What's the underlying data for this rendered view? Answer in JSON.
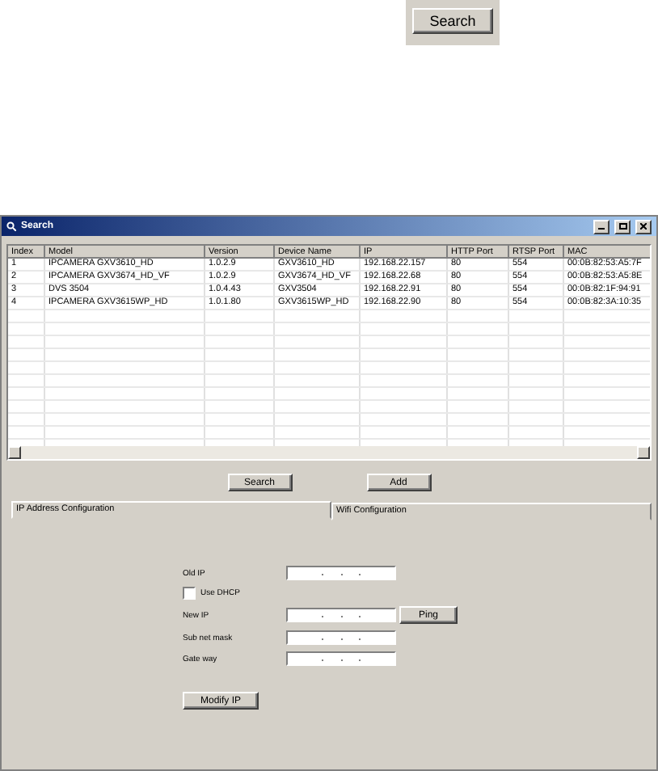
{
  "top_button": {
    "label": "Search"
  },
  "window": {
    "title": "Search"
  },
  "table": {
    "columns": [
      "Index",
      "Model",
      "Version",
      "Device Name",
      "IP",
      "HTTP Port",
      "RTSP Port",
      "MAC"
    ],
    "rows": [
      [
        "1",
        "IPCAMERA GXV3610_HD",
        "1.0.2.9",
        "GXV3610_HD",
        "192.168.22.157",
        "80",
        "554",
        "00:0B:82:53:A5:7F"
      ],
      [
        "2",
        "IPCAMERA GXV3674_HD_VF",
        "1.0.2.9",
        "GXV3674_HD_VF",
        "192.168.22.68",
        "80",
        "554",
        "00:0B:82:53:A5:8E"
      ],
      [
        "3",
        "DVS 3504",
        "1.0.4.43",
        "GXV3504",
        "192.168.22.91",
        "80",
        "554",
        "00:0B:82:1F:94:91"
      ],
      [
        "4",
        "IPCAMERA GXV3615WP_HD",
        "1.0.1.80",
        "GXV3615WP_HD",
        "192.168.22.90",
        "80",
        "554",
        "00:0B:82:3A:10:35"
      ]
    ]
  },
  "buttons": [
    "Search",
    "Add"
  ],
  "tabs": [
    {
      "label": "IP Address Configuration",
      "selected": true
    },
    {
      "label": "Wifi Configuration",
      "selected": false
    }
  ],
  "form": {
    "old_ip": {
      "label": "Old IP"
    },
    "use_dhcp": {
      "label": "Use DHCP",
      "checked": false
    },
    "new_ip": {
      "label": "New IP"
    },
    "ping": "Ping",
    "subnet_mask": {
      "label": "Sub net mask"
    },
    "gateway": {
      "label": "Gate way"
    },
    "modify": "Modify IP"
  }
}
